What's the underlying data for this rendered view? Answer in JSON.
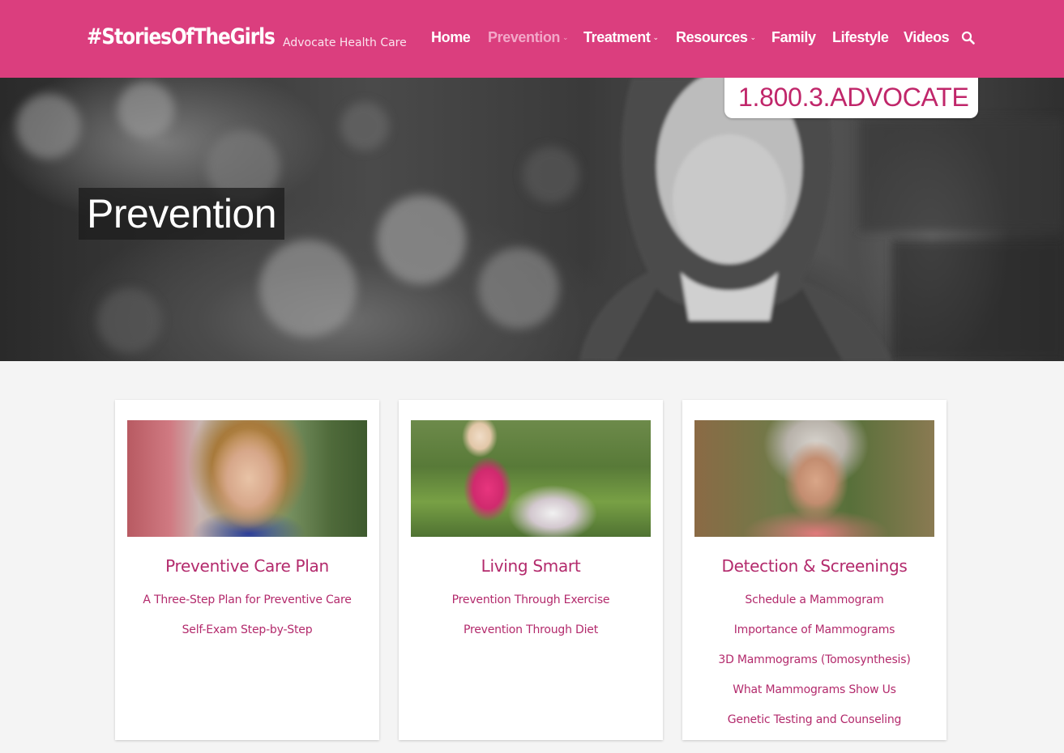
{
  "brand": {
    "logo": "#StoriesOfTheGirls",
    "sublabel": "Advocate Health Care",
    "accent_color": "#db3e7e",
    "link_color": "#b32a6c"
  },
  "nav": {
    "items": [
      {
        "label": "Home",
        "has_dropdown": false,
        "active": false
      },
      {
        "label": "Prevention",
        "has_dropdown": true,
        "active": true
      },
      {
        "label": "Treatment",
        "has_dropdown": true,
        "active": false
      },
      {
        "label": "Resources",
        "has_dropdown": true,
        "active": false
      },
      {
        "label": "Family",
        "has_dropdown": false,
        "active": false
      },
      {
        "label": "Lifestyle",
        "has_dropdown": false,
        "active": false
      },
      {
        "label": "Videos",
        "has_dropdown": false,
        "active": false
      }
    ],
    "search_icon": "search-icon",
    "dropdown_icon": "chevron-down-icon"
  },
  "hero": {
    "title": "Prevention",
    "phone": "1.800.3.ADVOCATE"
  },
  "cards": [
    {
      "title": "Preventive Care Plan",
      "links": [
        "A Three-Step Plan for Preventive Care",
        "Self-Exam Step-by-Step"
      ]
    },
    {
      "title": "Living Smart",
      "links": [
        "Prevention Through Exercise",
        "Prevention Through Diet"
      ]
    },
    {
      "title": "Detection & Screenings",
      "links": [
        "Schedule a Mammogram",
        "Importance of Mammograms",
        "3D Mammograms (Tomosynthesis)",
        "What Mammograms Show Us",
        "Genetic Testing and Counseling"
      ]
    }
  ]
}
